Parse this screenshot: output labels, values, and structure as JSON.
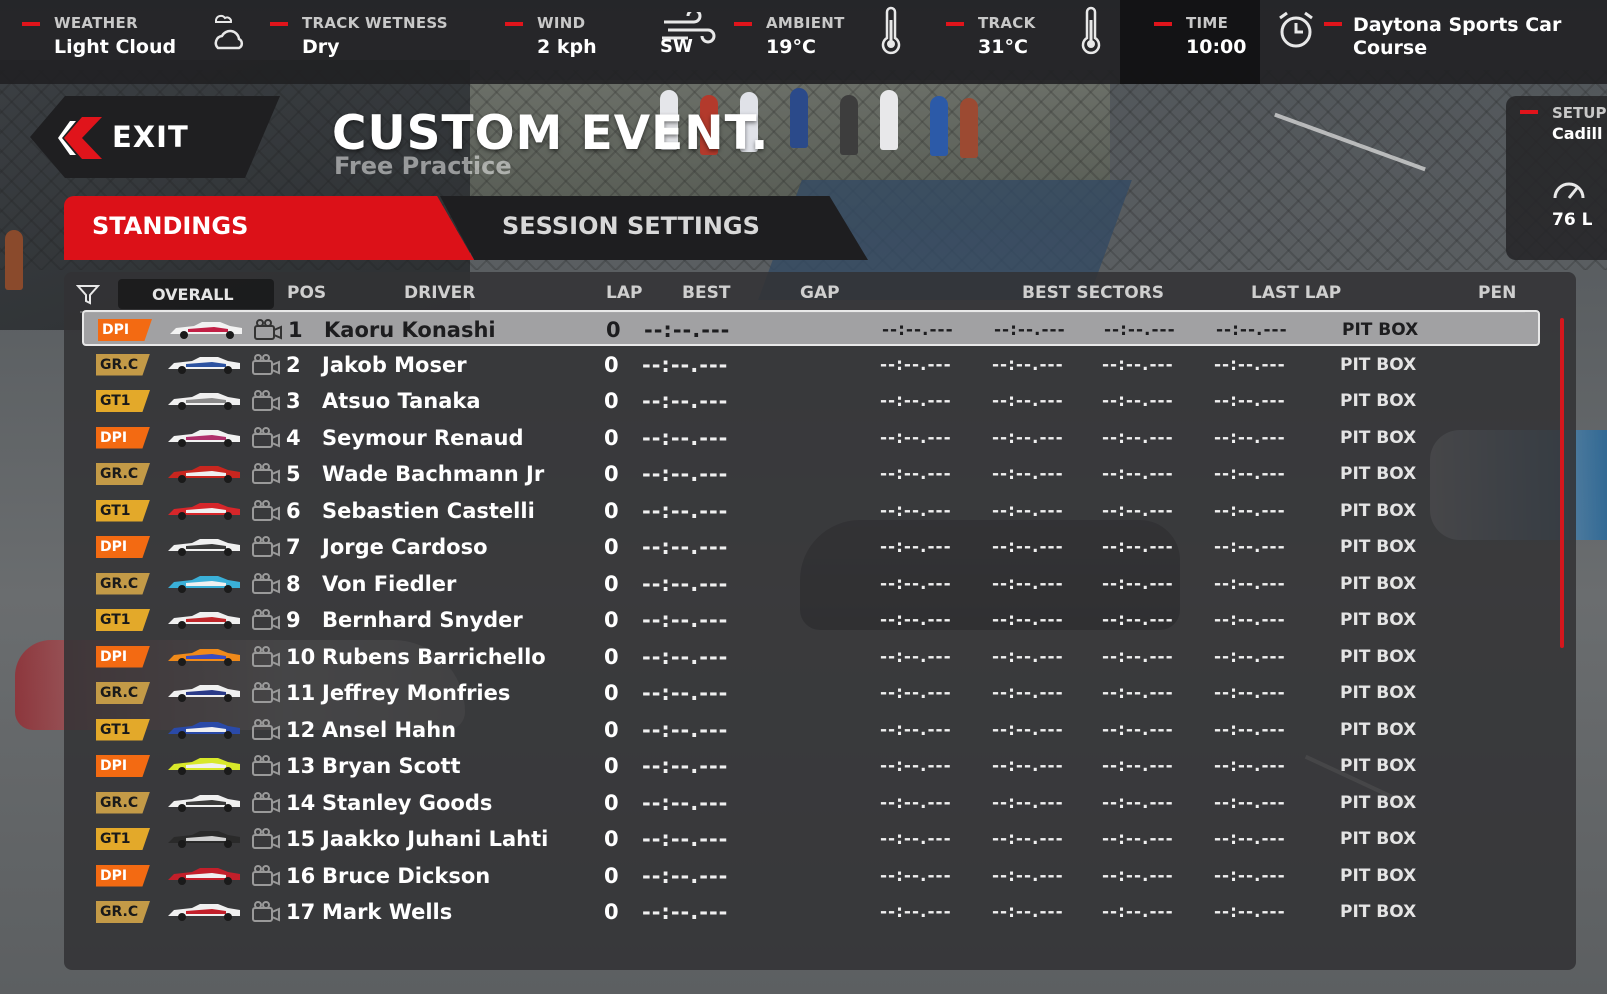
{
  "top_bar": {
    "weather": {
      "label": "WEATHER",
      "value": "Light Cloud",
      "icon": "cloud-icon"
    },
    "wetness": {
      "label": "TRACK WETNESS",
      "value": "Dry"
    },
    "wind": {
      "label": "WIND",
      "value": "2 kph",
      "direction": "SW",
      "icon": "wind-icon"
    },
    "ambient": {
      "label": "AMBIENT",
      "value": "19°C",
      "icon": "thermometer-icon"
    },
    "track": {
      "label": "TRACK",
      "value": "31°C",
      "icon": "thermometer-icon"
    },
    "time": {
      "label": "TIME",
      "value": "10:00",
      "icon": "alarm-clock-icon"
    },
    "track_name": "Daytona Sports Car Course"
  },
  "exit_label": "EXIT",
  "title": "CUSTOM EVENT.",
  "subtitle": "Free Practice",
  "tabs": {
    "standings": "STANDINGS",
    "settings": "SESSION SETTINGS"
  },
  "setup": {
    "label": "SETUP",
    "value": "Cadill",
    "fuel": "76 L"
  },
  "headers": {
    "overall": "OVERALL",
    "pos": "POS",
    "driver": "DRIVER",
    "lap": "LAP",
    "best": "BEST",
    "gap": "GAP",
    "best_sectors": "BEST SECTORS",
    "last_lap": "LAST LAP",
    "pen": "PEN"
  },
  "time_placeholder": "--:--.---",
  "rows": [
    {
      "cls": "DPI",
      "pos": "1",
      "driver": "Kaoru Konashi",
      "lap": "0",
      "pen": "PIT BOX"
    },
    {
      "cls": "GR.C",
      "pos": "2",
      "driver": "Jakob Moser",
      "lap": "0",
      "pen": "PIT BOX"
    },
    {
      "cls": "GT1",
      "pos": "3",
      "driver": "Atsuo Tanaka",
      "lap": "0",
      "pen": "PIT BOX"
    },
    {
      "cls": "DPI",
      "pos": "4",
      "driver": "Seymour Renaud",
      "lap": "0",
      "pen": "PIT BOX"
    },
    {
      "cls": "GR.C",
      "pos": "5",
      "driver": "Wade Bachmann Jr",
      "lap": "0",
      "pen": "PIT BOX"
    },
    {
      "cls": "GT1",
      "pos": "6",
      "driver": "Sebastien Castelli",
      "lap": "0",
      "pen": "PIT BOX"
    },
    {
      "cls": "DPI",
      "pos": "7",
      "driver": "Jorge Cardoso",
      "lap": "0",
      "pen": "PIT BOX"
    },
    {
      "cls": "GR.C",
      "pos": "8",
      "driver": "Von Fiedler",
      "lap": "0",
      "pen": "PIT BOX"
    },
    {
      "cls": "GT1",
      "pos": "9",
      "driver": "Bernhard Snyder",
      "lap": "0",
      "pen": "PIT BOX"
    },
    {
      "cls": "DPI",
      "pos": "10",
      "driver": "Rubens Barrichello",
      "lap": "0",
      "pen": "PIT BOX"
    },
    {
      "cls": "GR.C",
      "pos": "11",
      "driver": "Jeffrey Monfries",
      "lap": "0",
      "pen": "PIT BOX"
    },
    {
      "cls": "GT1",
      "pos": "12",
      "driver": "Ansel Hahn",
      "lap": "0",
      "pen": "PIT BOX"
    },
    {
      "cls": "DPI",
      "pos": "13",
      "driver": "Bryan Scott",
      "lap": "0",
      "pen": "PIT BOX"
    },
    {
      "cls": "GR.C",
      "pos": "14",
      "driver": "Stanley Goods",
      "lap": "0",
      "pen": "PIT BOX"
    },
    {
      "cls": "GT1",
      "pos": "15",
      "driver": "Jaakko Juhani Lahti",
      "lap": "0",
      "pen": "PIT BOX"
    },
    {
      "cls": "DPI",
      "pos": "16",
      "driver": "Bruce Dickson",
      "lap": "0",
      "pen": "PIT BOX"
    },
    {
      "cls": "GR.C",
      "pos": "17",
      "driver": "Mark Wells",
      "lap": "0",
      "pen": "PIT BOX"
    }
  ],
  "colors": {
    "accent": "#dc1118",
    "dpi": "#f36a12",
    "grc": "#c39a47",
    "gt1": "#e3a92a"
  }
}
